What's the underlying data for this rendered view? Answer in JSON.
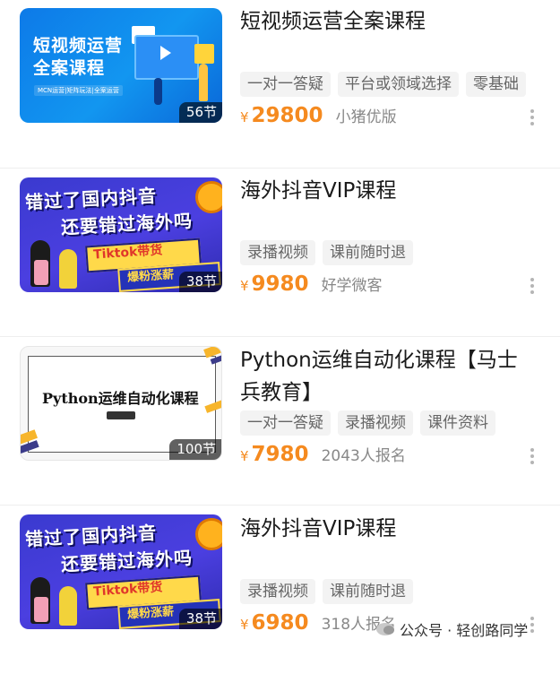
{
  "courses": [
    {
      "title": "短视频运营全案课程",
      "tags": [
        "一对一答疑",
        "平台或领域选择",
        "零基础"
      ],
      "currency": "¥",
      "price": "29800",
      "meta": "小猪优版",
      "lessons": "56节",
      "thumb": {
        "line1": "短视频运营",
        "line2": "全案课程",
        "sub": "MCN运营|矩阵玩法|全案运营"
      }
    },
    {
      "title": "海外抖音VIP课程",
      "tags": [
        "录播视频",
        "课前随时退"
      ],
      "currency": "¥",
      "price": "9980",
      "meta": "好学微客",
      "lessons": "38节",
      "thumb": {
        "line1": "错过了国内抖音",
        "line2": "还要错过海外吗",
        "y": "Tiktok带货",
        "b": "爆粉涨薪"
      }
    },
    {
      "title": "Python运维自动化课程【马士兵教育】",
      "tags": [
        "一对一答疑",
        "录播视频",
        "课件资料"
      ],
      "currency": "¥",
      "price": "7980",
      "meta": "2043人报名",
      "lessons": "100节",
      "thumb": {
        "title": "Python运维自动化课程"
      }
    },
    {
      "title": "海外抖音VIP课程",
      "tags": [
        "录播视频",
        "课前随时退"
      ],
      "currency": "¥",
      "price": "6980",
      "meta": "318人报名",
      "lessons": "38节",
      "thumb": {
        "line1": "错过了国内抖音",
        "line2": "还要错过海外吗",
        "y": "Tiktok带货",
        "b": "爆粉涨薪"
      }
    }
  ],
  "watermark": {
    "text": "公众号 · 轻创路同学"
  },
  "colors": {
    "price": "#f58a1f",
    "tag_bg": "#f3f3f3"
  }
}
